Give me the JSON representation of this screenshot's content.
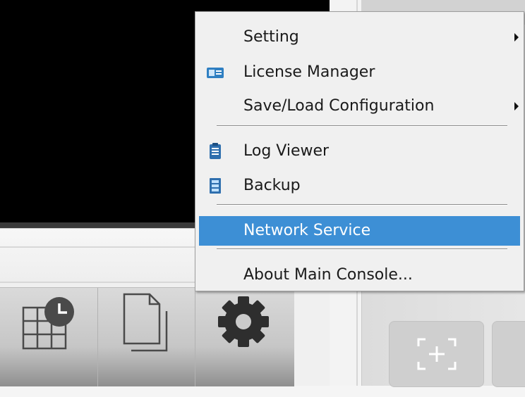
{
  "context_menu": {
    "items": [
      {
        "label": "Setting",
        "icon": null,
        "submenu": true
      },
      {
        "label": "License Manager",
        "icon": "license-card-icon",
        "submenu": false
      },
      {
        "label": "Save/Load Configuration",
        "icon": null,
        "submenu": true
      },
      {
        "label": "Log Viewer",
        "icon": "clipboard-icon",
        "submenu": false
      },
      {
        "label": "Backup",
        "icon": "backup-icon",
        "submenu": false
      },
      {
        "label": "Network Service",
        "icon": null,
        "submenu": false,
        "highlighted": true
      },
      {
        "label": "About Main Console...",
        "icon": null,
        "submenu": false
      }
    ]
  },
  "toolbar": {
    "buttons": [
      {
        "name": "schedule-grid-button",
        "icon": "grid-clock-icon"
      },
      {
        "name": "pages-button",
        "icon": "copy-pages-icon"
      },
      {
        "name": "settings-button",
        "icon": "gear-icon"
      }
    ]
  },
  "right_panel": {
    "add_button_icon": "expand-plus-icon"
  },
  "colors": {
    "menu_highlight": "#3d8fd5",
    "menu_background": "#f0f0f0",
    "video_background": "#000000"
  }
}
